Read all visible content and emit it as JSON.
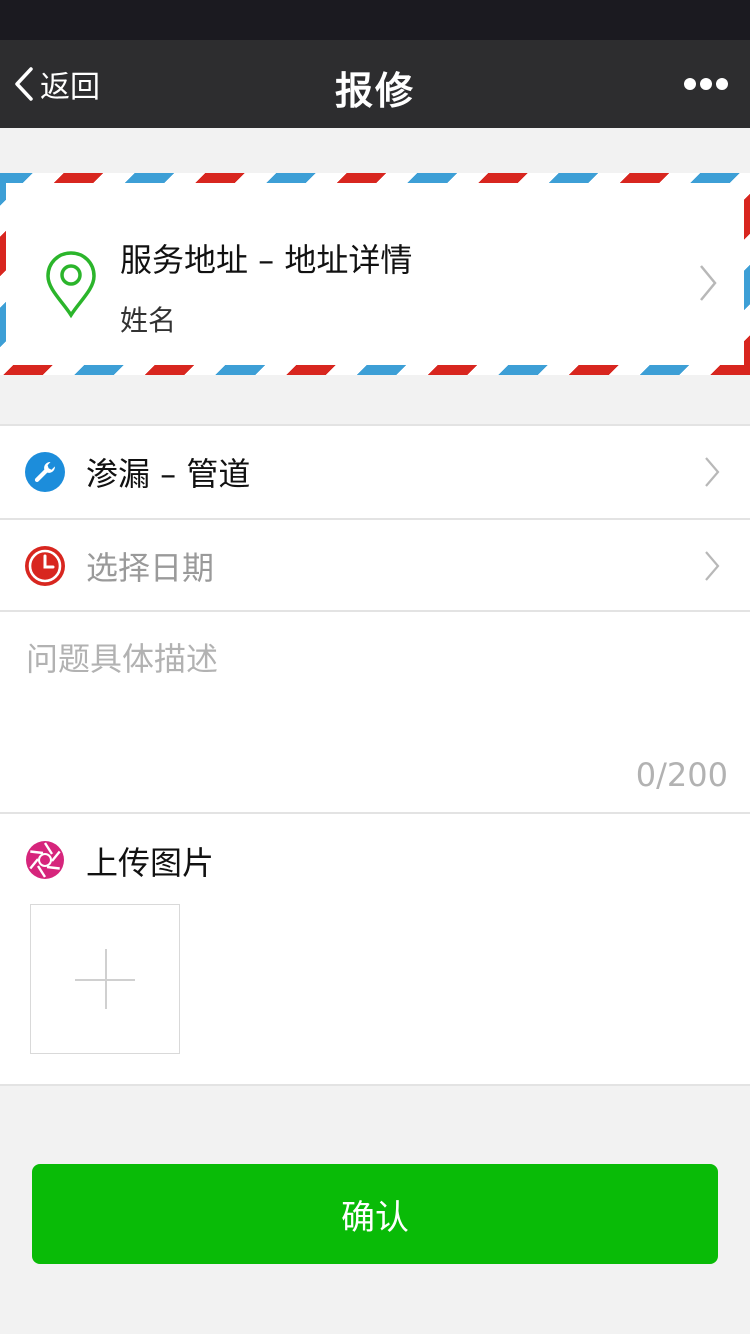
{
  "nav": {
    "back_label": "返回",
    "title": "报修",
    "more_icon": "more-dots-icon"
  },
  "address": {
    "icon": "location-pin-icon",
    "title": "服务地址 – 地址详情",
    "name": "姓名",
    "stripe_colors": [
      "#d8261f",
      "#3d9fd6"
    ],
    "pin_color": "#2bb52b"
  },
  "cells": {
    "category": {
      "icon": "wrench-icon",
      "label": "渗漏 – 管道",
      "icon_color": "#1c8ddb"
    },
    "date": {
      "icon": "clock-icon",
      "placeholder": "选择日期",
      "icon_color": "#d8261f"
    }
  },
  "description": {
    "placeholder": "问题具体描述",
    "counter": "0/200"
  },
  "upload": {
    "icon": "camera-aperture-icon",
    "title": "上传图片",
    "add_icon": "plus-icon",
    "icon_color": "#d6257c"
  },
  "confirm": {
    "label": "确认",
    "color": "#09bb07"
  }
}
